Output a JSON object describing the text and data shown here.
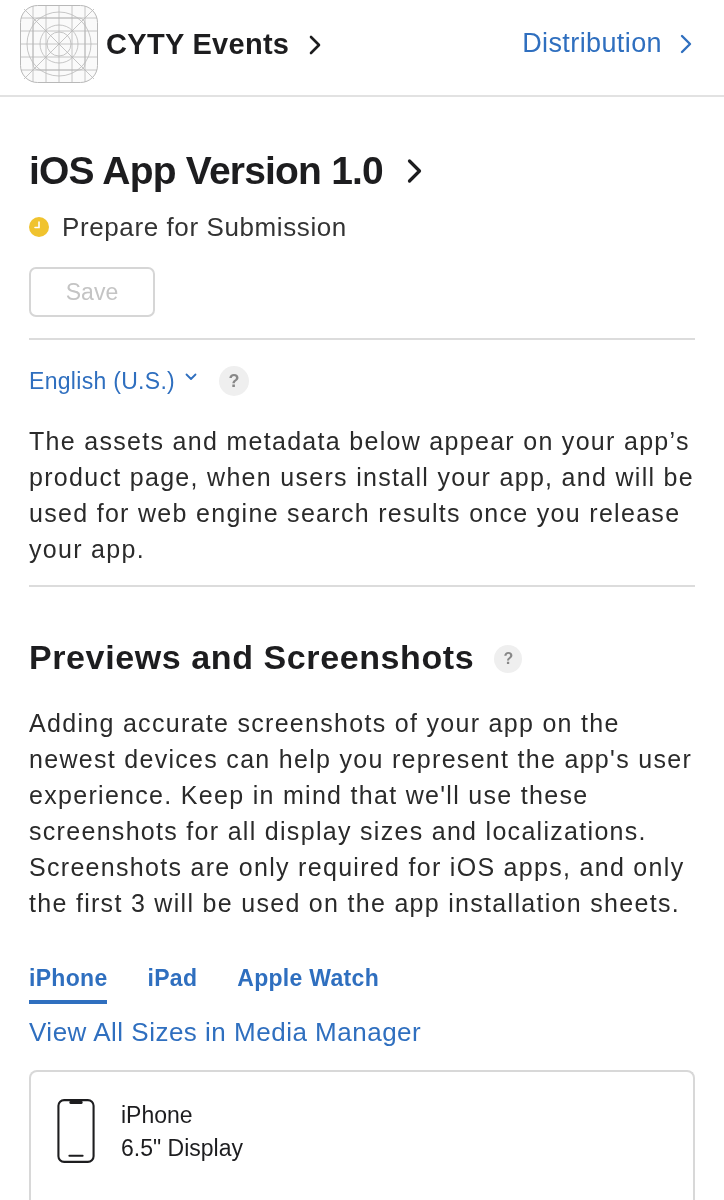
{
  "header": {
    "app_name": "CYTY Events",
    "distribution_link": "Distribution"
  },
  "version": {
    "title": "iOS App Version 1.0",
    "status": "Prepare for Submission",
    "save_button": {
      "label": "Save",
      "disabled": true
    }
  },
  "localization": {
    "language": "English (U.S.)",
    "help": "?",
    "description": "The assets and metadata below appear on your app’s product page, when users install your app, and will be used for web engine search results once you release your app."
  },
  "previews": {
    "heading": "Previews and Screenshots",
    "help": "?",
    "description": "Adding accurate screenshots of your app on the newest devices can help you represent the app's user experience. Keep in mind that we'll use these screenshots for all display sizes and localizations. Screenshots are only required for iOS apps, and only the first 3 will be used on the app installation sheets.",
    "tabs": [
      {
        "label": "iPhone",
        "selected": true
      },
      {
        "label": "iPad",
        "selected": false
      },
      {
        "label": "Apple Watch",
        "selected": false
      }
    ],
    "media_manager_link": "View All Sizes in Media Manager",
    "device_card": {
      "device": "iPhone",
      "display": "6.5\" Display"
    }
  }
}
